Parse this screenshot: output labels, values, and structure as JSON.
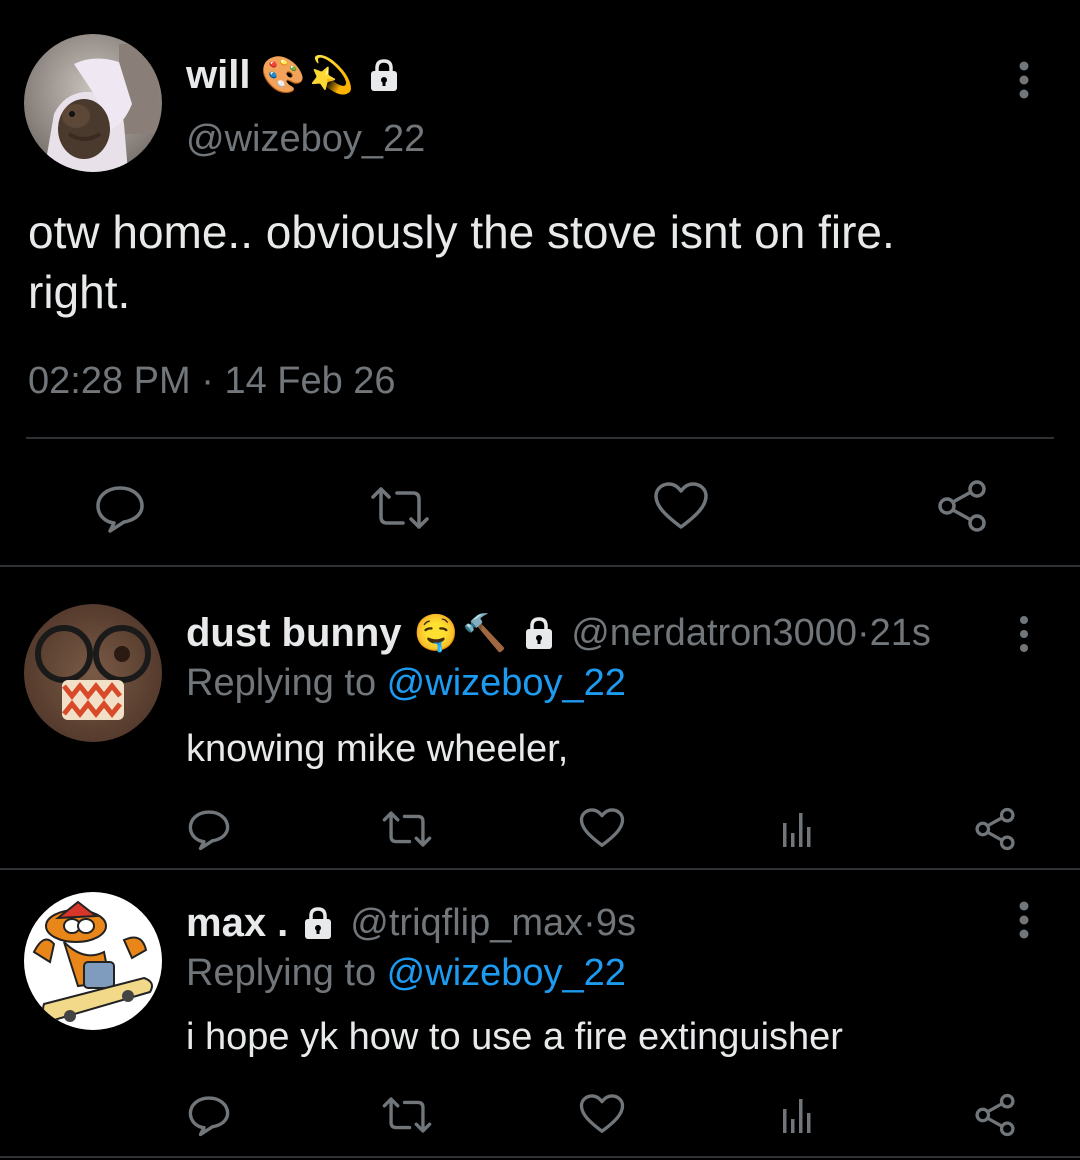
{
  "main_tweet": {
    "display_name": "will",
    "name_emojis": [
      "🎨",
      "💫"
    ],
    "handle": "@wizeboy_22",
    "text_line1": "otw home.. obviously the stove isnt on fire.",
    "text_line2": "right.",
    "time": "02:28 PM",
    "separator": " · ",
    "date": "14 Feb 26",
    "protected": true,
    "actions": [
      "reply-icon",
      "retweet-icon",
      "like-icon",
      "share-icon"
    ]
  },
  "replies": [
    {
      "display_name": "dust bunny",
      "name_emojis": [
        "🤤",
        "🔨"
      ],
      "handle": "@nerdatron3000",
      "age": "21s",
      "replying_prefix": "Replying to ",
      "replying_to": "@wizeboy_22",
      "text": "knowing mike wheeler,",
      "protected": true,
      "actions": [
        "reply-icon",
        "retweet-icon",
        "like-icon",
        "analytics-icon",
        "share-icon"
      ]
    },
    {
      "display_name": "max .",
      "name_emojis": [],
      "handle": "@triqflip_max",
      "age": "9s",
      "replying_prefix": "Replying to ",
      "replying_to": "@wizeboy_22",
      "text": "i hope yk how to use a fire extinguisher",
      "protected": true,
      "actions": [
        "reply-icon",
        "retweet-icon",
        "like-icon",
        "analytics-icon",
        "share-icon"
      ]
    }
  ],
  "separator_dot": " · ",
  "colors": {
    "background": "#000000",
    "primary_text": "#e7e9ea",
    "secondary_text": "#71767b",
    "link": "#1d9bf0",
    "divider": "#2f3336"
  }
}
